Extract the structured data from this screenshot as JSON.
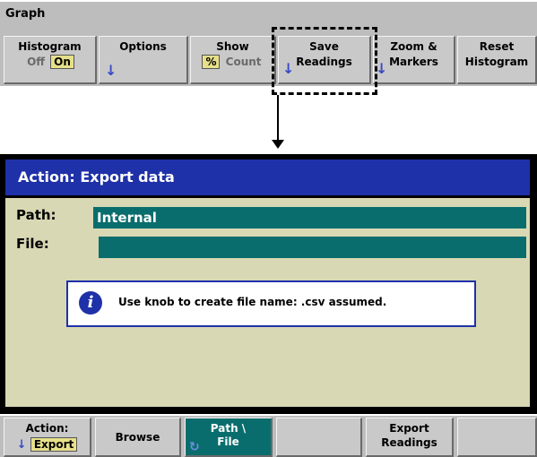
{
  "top_bar": {
    "title": "Graph",
    "softkeys": [
      {
        "line1": "Histogram",
        "opt_off": "Off",
        "opt_on": "On"
      },
      {
        "line1": "Options"
      },
      {
        "line1": "Show",
        "opt_pct": "%",
        "opt_count": "Count"
      },
      {
        "line1": "Save",
        "line2": "Readings"
      },
      {
        "line1": "Zoom &",
        "line2": "Markers"
      },
      {
        "line1": "Reset",
        "line2": "Histogram"
      }
    ]
  },
  "dialog": {
    "title": "Action: Export data",
    "path_label": "Path:",
    "path_value": "Internal",
    "file_label": "File:",
    "file_value": "",
    "message": "Use knob to create file name: .csv assumed.",
    "info_glyph": "i"
  },
  "bottom_bar": {
    "softkeys": [
      {
        "line1": "Action:",
        "line2": "Export"
      },
      {
        "line1": "Browse"
      },
      {
        "line1": "Path \\",
        "line2": "File"
      },
      {
        "line1": ""
      },
      {
        "line1": "Export",
        "line2": "Readings"
      },
      {
        "line1": ""
      }
    ]
  },
  "colors": {
    "title_bar": "#1f31a8",
    "field_fill": "#0a6d6d",
    "dialog_body": "#d8d8b4",
    "softkey_bg": "#c9c9c9",
    "arrow": "#3b48c8"
  },
  "icons": {
    "submenu_arrow": "down-arrow-icon",
    "info": "info-icon",
    "knob": "knob-icon"
  }
}
